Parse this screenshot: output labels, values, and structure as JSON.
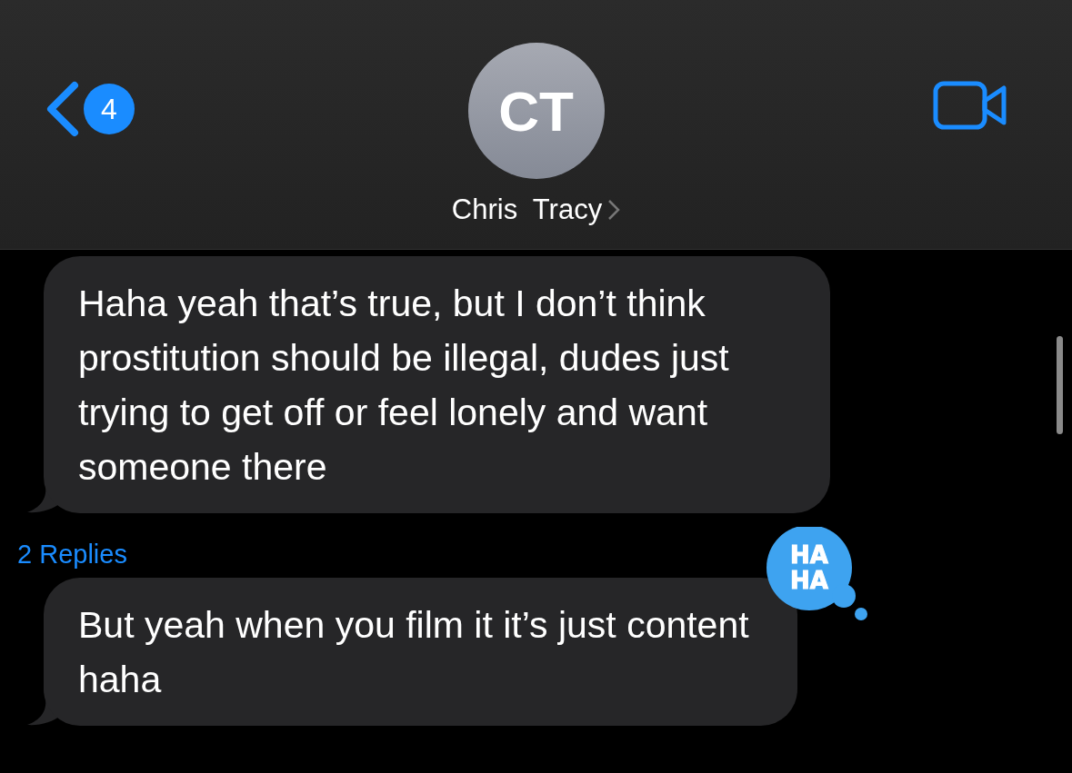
{
  "header": {
    "back_badge": "4",
    "avatar_initials": "CT",
    "contact_name": "Chris  Tracy"
  },
  "messages": [
    {
      "text": "Haha yeah that’s true, but I don’t think prostitution should be illegal, dudes just trying to get off or feel lonely and want someone there",
      "replies": "2 Replies"
    },
    {
      "text": "But yeah when you film it it’s just content haha",
      "tapback": {
        "kind": "haha",
        "lines": [
          "HA",
          "HA"
        ]
      }
    }
  ]
}
